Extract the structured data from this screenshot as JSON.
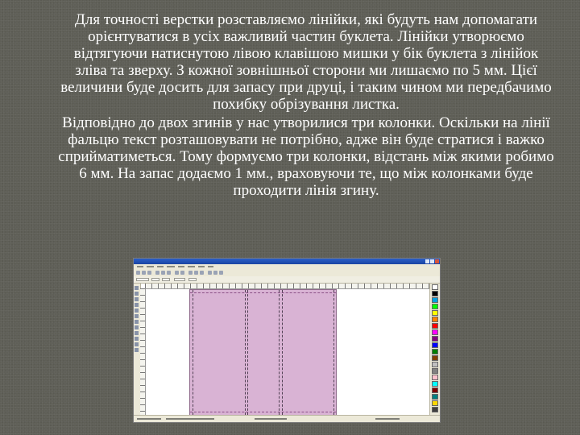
{
  "paragraphs": [
    "Для точності верстки розставляємо лінійки, які будуть нам допомагати орієнтуватися в усіх важливий частин буклета. Лінійки утворюємо відтягуючи натиснутою лівою клавішою мишки у бік буклета з лінійок зліва та зверху.  З кожної зовнішньої сторони ми лишаємо по 5 мм. Цієї величини буде досить для запасу при друці, і таким чином ми передбачимо похибку обрізування листка.",
    "Відповідно до двох згинів у нас утворилися три колонки. Оскільки на лінії фальцю текст розташовувати не потрібно, адже він буде стратися і важко сприйматиметься. Тому формуємо три колонки, відстань між якими робимо 6 мм. На запас додаємо 1 мм., враховуючи те, що між колонками буде проходити лінія згину."
  ],
  "screenshot": {
    "page_color": "#d9b3d4",
    "palette_colors": [
      "#ffffff",
      "#000000",
      "#00a0e0",
      "#00ff00",
      "#ffff00",
      "#ff8000",
      "#ff0000",
      "#ff00ff",
      "#800080",
      "#0000ff",
      "#008000",
      "#804000",
      "#c0c0c0",
      "#808080",
      "#ffc0cb",
      "#00ffff",
      "#800000",
      "#008080",
      "#ffd700",
      "#404040"
    ]
  }
}
